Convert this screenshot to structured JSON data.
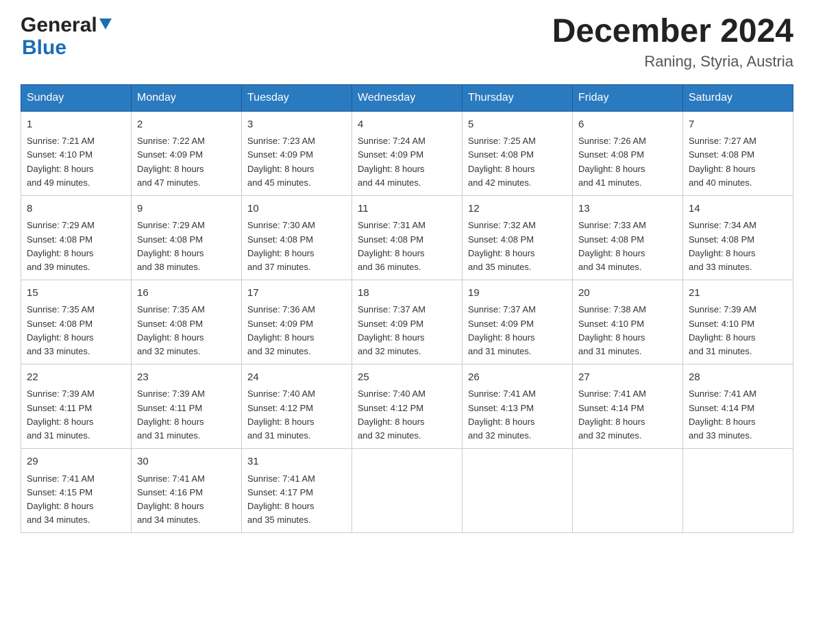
{
  "logo": {
    "general": "General",
    "blue": "Blue"
  },
  "title": "December 2024",
  "subtitle": "Raning, Styria, Austria",
  "days": [
    "Sunday",
    "Monday",
    "Tuesday",
    "Wednesday",
    "Thursday",
    "Friday",
    "Saturday"
  ],
  "weeks": [
    [
      {
        "day": "1",
        "sunrise": "7:21 AM",
        "sunset": "4:10 PM",
        "daylight_h": "8",
        "daylight_m": "49"
      },
      {
        "day": "2",
        "sunrise": "7:22 AM",
        "sunset": "4:09 PM",
        "daylight_h": "8",
        "daylight_m": "47"
      },
      {
        "day": "3",
        "sunrise": "7:23 AM",
        "sunset": "4:09 PM",
        "daylight_h": "8",
        "daylight_m": "45"
      },
      {
        "day": "4",
        "sunrise": "7:24 AM",
        "sunset": "4:09 PM",
        "daylight_h": "8",
        "daylight_m": "44"
      },
      {
        "day": "5",
        "sunrise": "7:25 AM",
        "sunset": "4:08 PM",
        "daylight_h": "8",
        "daylight_m": "42"
      },
      {
        "day": "6",
        "sunrise": "7:26 AM",
        "sunset": "4:08 PM",
        "daylight_h": "8",
        "daylight_m": "41"
      },
      {
        "day": "7",
        "sunrise": "7:27 AM",
        "sunset": "4:08 PM",
        "daylight_h": "8",
        "daylight_m": "40"
      }
    ],
    [
      {
        "day": "8",
        "sunrise": "7:29 AM",
        "sunset": "4:08 PM",
        "daylight_h": "8",
        "daylight_m": "39"
      },
      {
        "day": "9",
        "sunrise": "7:29 AM",
        "sunset": "4:08 PM",
        "daylight_h": "8",
        "daylight_m": "38"
      },
      {
        "day": "10",
        "sunrise": "7:30 AM",
        "sunset": "4:08 PM",
        "daylight_h": "8",
        "daylight_m": "37"
      },
      {
        "day": "11",
        "sunrise": "7:31 AM",
        "sunset": "4:08 PM",
        "daylight_h": "8",
        "daylight_m": "36"
      },
      {
        "day": "12",
        "sunrise": "7:32 AM",
        "sunset": "4:08 PM",
        "daylight_h": "8",
        "daylight_m": "35"
      },
      {
        "day": "13",
        "sunrise": "7:33 AM",
        "sunset": "4:08 PM",
        "daylight_h": "8",
        "daylight_m": "34"
      },
      {
        "day": "14",
        "sunrise": "7:34 AM",
        "sunset": "4:08 PM",
        "daylight_h": "8",
        "daylight_m": "33"
      }
    ],
    [
      {
        "day": "15",
        "sunrise": "7:35 AM",
        "sunset": "4:08 PM",
        "daylight_h": "8",
        "daylight_m": "33"
      },
      {
        "day": "16",
        "sunrise": "7:35 AM",
        "sunset": "4:08 PM",
        "daylight_h": "8",
        "daylight_m": "32"
      },
      {
        "day": "17",
        "sunrise": "7:36 AM",
        "sunset": "4:09 PM",
        "daylight_h": "8",
        "daylight_m": "32"
      },
      {
        "day": "18",
        "sunrise": "7:37 AM",
        "sunset": "4:09 PM",
        "daylight_h": "8",
        "daylight_m": "32"
      },
      {
        "day": "19",
        "sunrise": "7:37 AM",
        "sunset": "4:09 PM",
        "daylight_h": "8",
        "daylight_m": "31"
      },
      {
        "day": "20",
        "sunrise": "7:38 AM",
        "sunset": "4:10 PM",
        "daylight_h": "8",
        "daylight_m": "31"
      },
      {
        "day": "21",
        "sunrise": "7:39 AM",
        "sunset": "4:10 PM",
        "daylight_h": "8",
        "daylight_m": "31"
      }
    ],
    [
      {
        "day": "22",
        "sunrise": "7:39 AM",
        "sunset": "4:11 PM",
        "daylight_h": "8",
        "daylight_m": "31"
      },
      {
        "day": "23",
        "sunrise": "7:39 AM",
        "sunset": "4:11 PM",
        "daylight_h": "8",
        "daylight_m": "31"
      },
      {
        "day": "24",
        "sunrise": "7:40 AM",
        "sunset": "4:12 PM",
        "daylight_h": "8",
        "daylight_m": "31"
      },
      {
        "day": "25",
        "sunrise": "7:40 AM",
        "sunset": "4:12 PM",
        "daylight_h": "8",
        "daylight_m": "32"
      },
      {
        "day": "26",
        "sunrise": "7:41 AM",
        "sunset": "4:13 PM",
        "daylight_h": "8",
        "daylight_m": "32"
      },
      {
        "day": "27",
        "sunrise": "7:41 AM",
        "sunset": "4:14 PM",
        "daylight_h": "8",
        "daylight_m": "32"
      },
      {
        "day": "28",
        "sunrise": "7:41 AM",
        "sunset": "4:14 PM",
        "daylight_h": "8",
        "daylight_m": "33"
      }
    ],
    [
      {
        "day": "29",
        "sunrise": "7:41 AM",
        "sunset": "4:15 PM",
        "daylight_h": "8",
        "daylight_m": "34"
      },
      {
        "day": "30",
        "sunrise": "7:41 AM",
        "sunset": "4:16 PM",
        "daylight_h": "8",
        "daylight_m": "34"
      },
      {
        "day": "31",
        "sunrise": "7:41 AM",
        "sunset": "4:17 PM",
        "daylight_h": "8",
        "daylight_m": "35"
      },
      null,
      null,
      null,
      null
    ]
  ],
  "labels": {
    "sunrise": "Sunrise:",
    "sunset": "Sunset:",
    "daylight": "Daylight:",
    "hours": "hours",
    "and": "and",
    "minutes": "minutes."
  }
}
